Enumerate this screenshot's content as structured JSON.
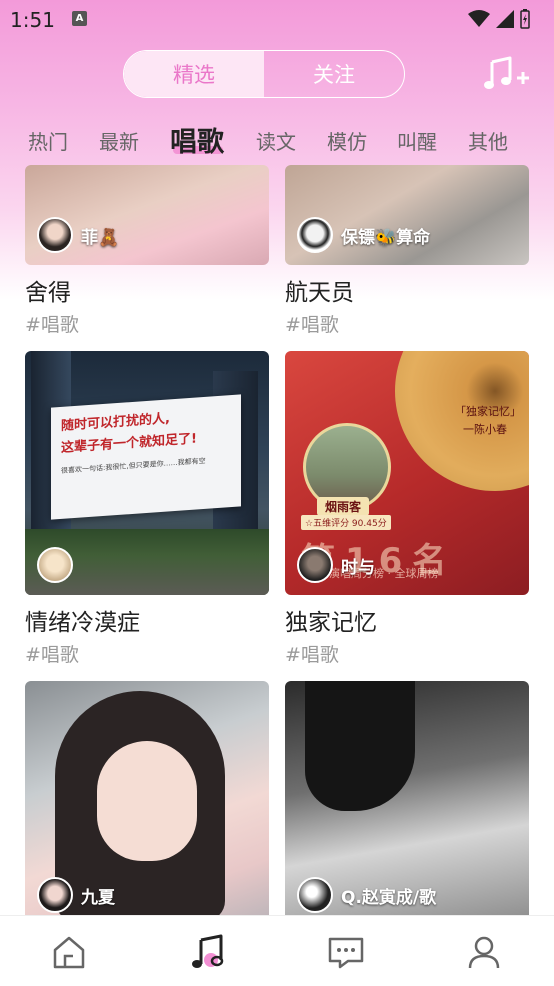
{
  "status": {
    "time": "1:51",
    "notification_glyph": "A"
  },
  "top_tabs": {
    "featured": "精选",
    "following": "关注"
  },
  "categories": [
    "热门",
    "最新",
    "唱歌",
    "读文",
    "模仿",
    "叫醒",
    "其他"
  ],
  "active_category": "唱歌",
  "accent": "#f28fd3",
  "cards": [
    {
      "title": "舍得",
      "tag": "#唱歌",
      "author": "菲🧸"
    },
    {
      "title": "航天员",
      "tag": "#唱歌",
      "author": "保镖🐝算命"
    },
    {
      "title": "情绪冷漠症",
      "tag": "#唱歌",
      "author": "",
      "billboard_line1": "随时可以打扰的人,",
      "billboard_line2": "这辈子有一个就知足了!",
      "billboard_line3": "很喜欢一句话:我很忙,但只要是你……我都有空"
    },
    {
      "title": "独家记忆",
      "tag": "#唱歌",
      "author": "时与",
      "poster_song": "「独家记忆」",
      "poster_singer": "一陈小春",
      "poster_name": "烟雨客",
      "poster_score": "☆五维评分 90.45分",
      "poster_rank": "第16名",
      "poster_rank_sub": "演唱周分榜 · 全球周榜"
    },
    {
      "title": "",
      "tag": "",
      "author": "九夏"
    },
    {
      "title": "",
      "tag": "",
      "author": "Q.赵寅成/歌"
    }
  ],
  "nav": [
    "home-icon",
    "music-icon",
    "message-icon",
    "profile-icon"
  ]
}
